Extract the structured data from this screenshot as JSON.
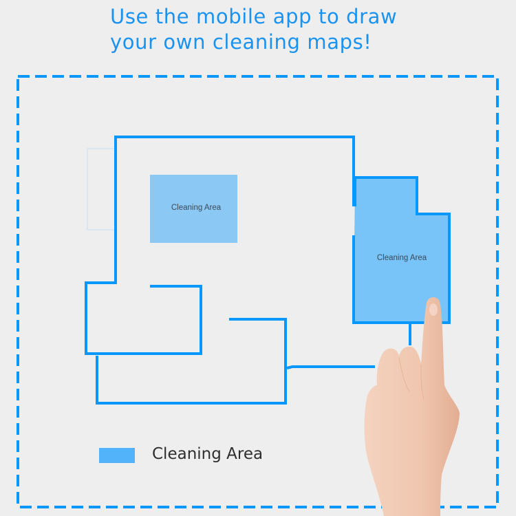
{
  "headline": {
    "line1": "Use the mobile app to draw",
    "line2": "your own cleaning maps!"
  },
  "map": {
    "areas": [
      {
        "label": "Cleaning Area"
      },
      {
        "label": "Cleaning Area"
      }
    ]
  },
  "legend": {
    "label": "Cleaning Area",
    "swatch_color": "#52b2fa"
  },
  "colors": {
    "accent": "#0898fd",
    "area_fill": "#78c3f7",
    "background": "#eeeeee",
    "headline": "#1a93f0"
  },
  "icons": {
    "hand": "pointing-hand-icon"
  }
}
